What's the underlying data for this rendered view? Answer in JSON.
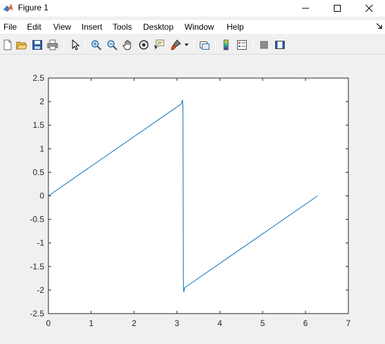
{
  "window": {
    "title": "Figure 1"
  },
  "menu": {
    "items": [
      "File",
      "Edit",
      "View",
      "Insert",
      "Tools",
      "Desktop",
      "Window",
      "Help"
    ]
  },
  "toolbar": {
    "buttons": [
      "new-figure",
      "open-file",
      "save",
      "print",
      "edit-plot",
      "zoom-in",
      "zoom-out",
      "pan",
      "rotate-3d",
      "data-cursor",
      "brush",
      "link-plot",
      "insert-colorbar",
      "insert-legend",
      "hide-plot-tools",
      "show-plot-tools"
    ]
  },
  "chart_data": {
    "type": "line",
    "title": "",
    "xlabel": "",
    "ylabel": "",
    "xlim": [
      0,
      7
    ],
    "ylim": [
      -2.5,
      2.5
    ],
    "xticks": [
      "0",
      "1",
      "2",
      "3",
      "4",
      "5",
      "6",
      "7"
    ],
    "yticks": [
      "-2.5",
      "-2",
      "-1.5",
      "-1",
      "-0.5",
      "0",
      "0.5",
      "1",
      "1.5",
      "2",
      "2.5"
    ],
    "grid": false,
    "line_color": "#0072BD",
    "series": [
      {
        "x": [
          0,
          3.1,
          3.13,
          3.14,
          3.15,
          3.16,
          3.18,
          6.283
        ],
        "y": [
          0,
          1.95,
          2.03,
          1.9,
          -1.9,
          -2.04,
          -1.95,
          0
        ]
      }
    ]
  }
}
